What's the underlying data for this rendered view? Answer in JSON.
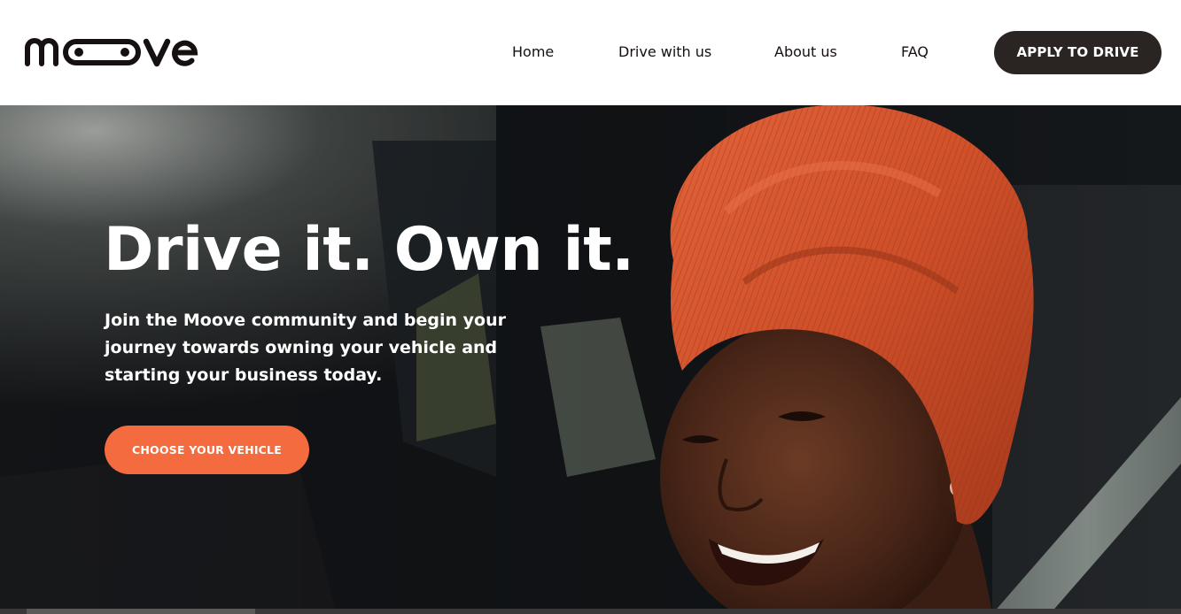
{
  "header": {
    "logo_text": "moove",
    "nav": {
      "home": "Home",
      "drive_with_us": "Drive with us",
      "about_us": "About us",
      "faq": "FAQ"
    },
    "cta_label": "APPLY TO DRIVE"
  },
  "hero": {
    "title": "Drive it. Own it.",
    "subtitle": "Join the Moove community and begin your journey towards owning your vehicle and starting your business today.",
    "cta_label": "CHOOSE YOUR VEHICLE",
    "image_subject": "smiling woman wearing an orange head wrap, seated in a car"
  },
  "colors": {
    "brand_dark": "#161010",
    "button_dark": "#2a2523",
    "accent_orange": "#f46b3f",
    "head_wrap_orange": "#d8542c",
    "hero_text": "#ffffff"
  }
}
